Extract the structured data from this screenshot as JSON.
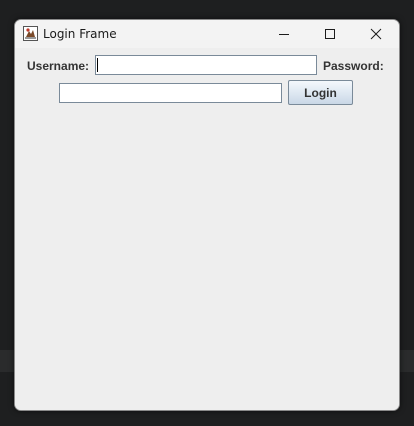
{
  "window": {
    "title": "Login Frame",
    "icon": "java-app-icon",
    "controls": {
      "minimize": "minimize-icon",
      "maximize": "maximize-icon",
      "close": "close-icon"
    }
  },
  "form": {
    "username_label": "Username:",
    "username_value": "",
    "password_label": "Password:",
    "password_value": "",
    "login_button": "Login"
  },
  "colors": {
    "window_bg": "#eeeeee",
    "desktop_bg": "#1e1f20",
    "field_border": "#7a8a99",
    "button_gradient_top": "#f4f8fc",
    "button_gradient_bottom": "#c9d7e6"
  }
}
